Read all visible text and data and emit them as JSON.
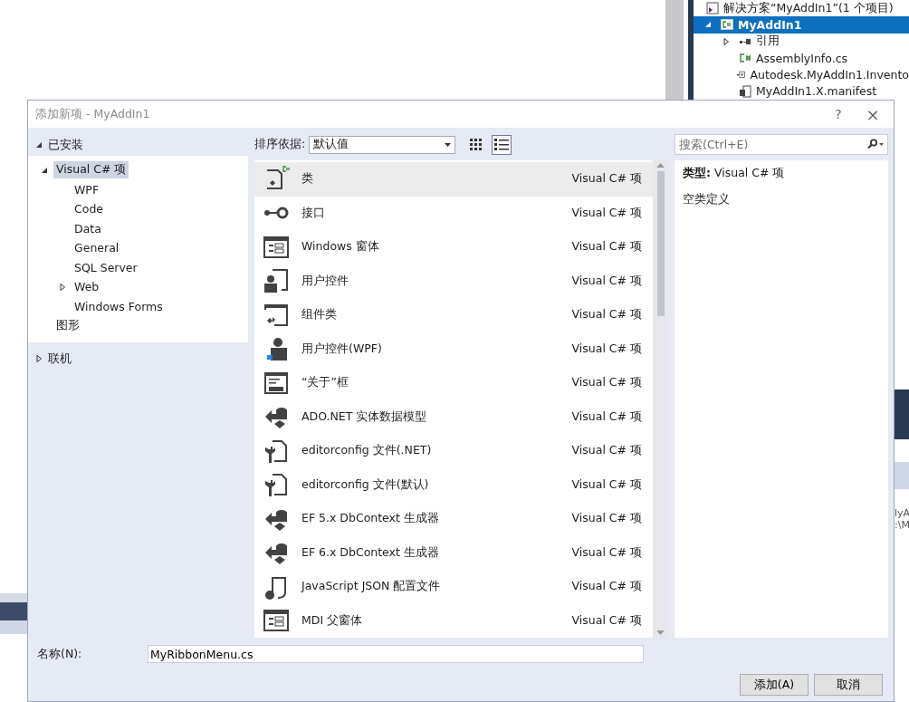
{
  "solution_explorer": {
    "solution": "解决方案“MyAddIn1”(1 个项目)",
    "items": [
      {
        "label": "MyAddIn1",
        "kind": "project",
        "selected": true,
        "expanded": true
      },
      {
        "label": "引用",
        "kind": "references",
        "selected": false,
        "expanded": false
      },
      {
        "label": "AssemblyInfo.cs",
        "kind": "csfile",
        "selected": false
      },
      {
        "label": "Autodesk.MyAddIn1.Invento",
        "kind": "addin",
        "selected": false
      },
      {
        "label": "MyAddIn1.X.manifest",
        "kind": "manifest",
        "selected": false
      }
    ]
  },
  "background_fragments": [
    "lyA",
    ":\\M"
  ],
  "dialog": {
    "title": "添加新项 - MyAddIn1",
    "help": "?",
    "close": "×",
    "installed": {
      "label": "已安装",
      "expanded": true
    },
    "tree": [
      {
        "label": "Visual C# 项",
        "selected": true,
        "expanded": true,
        "children": [
          {
            "label": "WPF",
            "selected": false
          },
          {
            "label": "Code",
            "selected": false
          },
          {
            "label": "Data",
            "selected": false
          },
          {
            "label": "General",
            "selected": false
          },
          {
            "label": "SQL Server",
            "selected": false
          },
          {
            "label": "Web",
            "selected": false,
            "expanded": false
          },
          {
            "label": "Windows Forms",
            "selected": false
          }
        ]
      },
      {
        "label": "图形",
        "selected": false
      }
    ],
    "online": {
      "label": "联机",
      "expanded": false
    },
    "sort": {
      "label": "排序依据:",
      "value": "默认值"
    },
    "views": [
      {
        "kind": "grid",
        "selected": false
      },
      {
        "kind": "list",
        "selected": true
      }
    ],
    "search": {
      "placeholder": "搜索(Ctrl+E)"
    },
    "templates": [
      {
        "name": "类",
        "category": "Visual C# 项",
        "kind": "class",
        "selected": true
      },
      {
        "name": "接口",
        "category": "Visual C# 项",
        "kind": "interface",
        "selected": false
      },
      {
        "name": "Windows 窗体",
        "category": "Visual C# 项",
        "kind": "form",
        "selected": false
      },
      {
        "name": "用户控件",
        "category": "Visual C# 项",
        "kind": "usercontrol",
        "selected": false
      },
      {
        "name": "组件类",
        "category": "Visual C# 项",
        "kind": "component",
        "selected": false
      },
      {
        "name": "用户控件(WPF)",
        "category": "Visual C# 项",
        "kind": "wpf",
        "selected": false
      },
      {
        "name": "“关于”框",
        "category": "Visual C# 项",
        "kind": "about",
        "selected": false
      },
      {
        "name": "ADO.NET 实体数据模型",
        "category": "Visual C# 项",
        "kind": "model",
        "selected": false
      },
      {
        "name": "editorconfig 文件(.NET)",
        "category": "Visual C# 项",
        "kind": "config",
        "selected": false
      },
      {
        "name": "editorconfig 文件(默认)",
        "category": "Visual C# 项",
        "kind": "config",
        "selected": false
      },
      {
        "name": "EF 5.x DbContext 生成器",
        "category": "Visual C# 项",
        "kind": "model",
        "selected": false
      },
      {
        "name": "EF 6.x DbContext 生成器",
        "category": "Visual C# 项",
        "kind": "model",
        "selected": false
      },
      {
        "name": "JavaScript JSON 配置文件",
        "category": "Visual C# 项",
        "kind": "json",
        "selected": false
      },
      {
        "name": "MDI 父窗体",
        "category": "Visual C# 项",
        "kind": "form",
        "selected": false
      }
    ],
    "details": {
      "type_label": "类型:",
      "type_value": "Visual C# 项",
      "description": "空类定义"
    },
    "name_field": {
      "label": "名称(N):",
      "value": "MyRibbonMenu.cs"
    },
    "buttons": [
      {
        "label": "添加(A)"
      },
      {
        "label": "取消"
      }
    ]
  }
}
